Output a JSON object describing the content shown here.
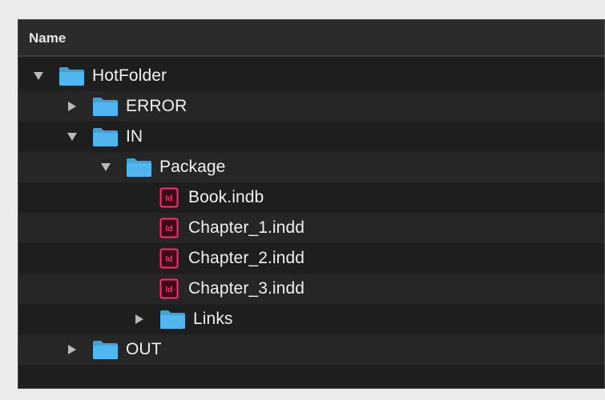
{
  "header": {
    "column_name": "Name"
  },
  "colors": {
    "folder": "#4fb6f0",
    "indesign_icon": "#ff2f6e",
    "row_dark": "#1e1e1e",
    "row_alt": "#262626",
    "text": "#f0f0f0"
  },
  "tree": [
    {
      "name": "HotFolder",
      "type": "folder",
      "level": 0,
      "expanded": true
    },
    {
      "name": "ERROR",
      "type": "folder",
      "level": 1,
      "expanded": false
    },
    {
      "name": "IN",
      "type": "folder",
      "level": 1,
      "expanded": true
    },
    {
      "name": "Package",
      "type": "folder",
      "level": 2,
      "expanded": true
    },
    {
      "name": "Book.indb",
      "type": "indesign-file",
      "level": 3
    },
    {
      "name": "Chapter_1.indd",
      "type": "indesign-file",
      "level": 3
    },
    {
      "name": "Chapter_2.indd",
      "type": "indesign-file",
      "level": 3
    },
    {
      "name": "Chapter_3.indd",
      "type": "indesign-file",
      "level": 3
    },
    {
      "name": "Links",
      "type": "folder",
      "level": 3,
      "expanded": false
    },
    {
      "name": "OUT",
      "type": "folder",
      "level": 1,
      "expanded": false
    }
  ]
}
